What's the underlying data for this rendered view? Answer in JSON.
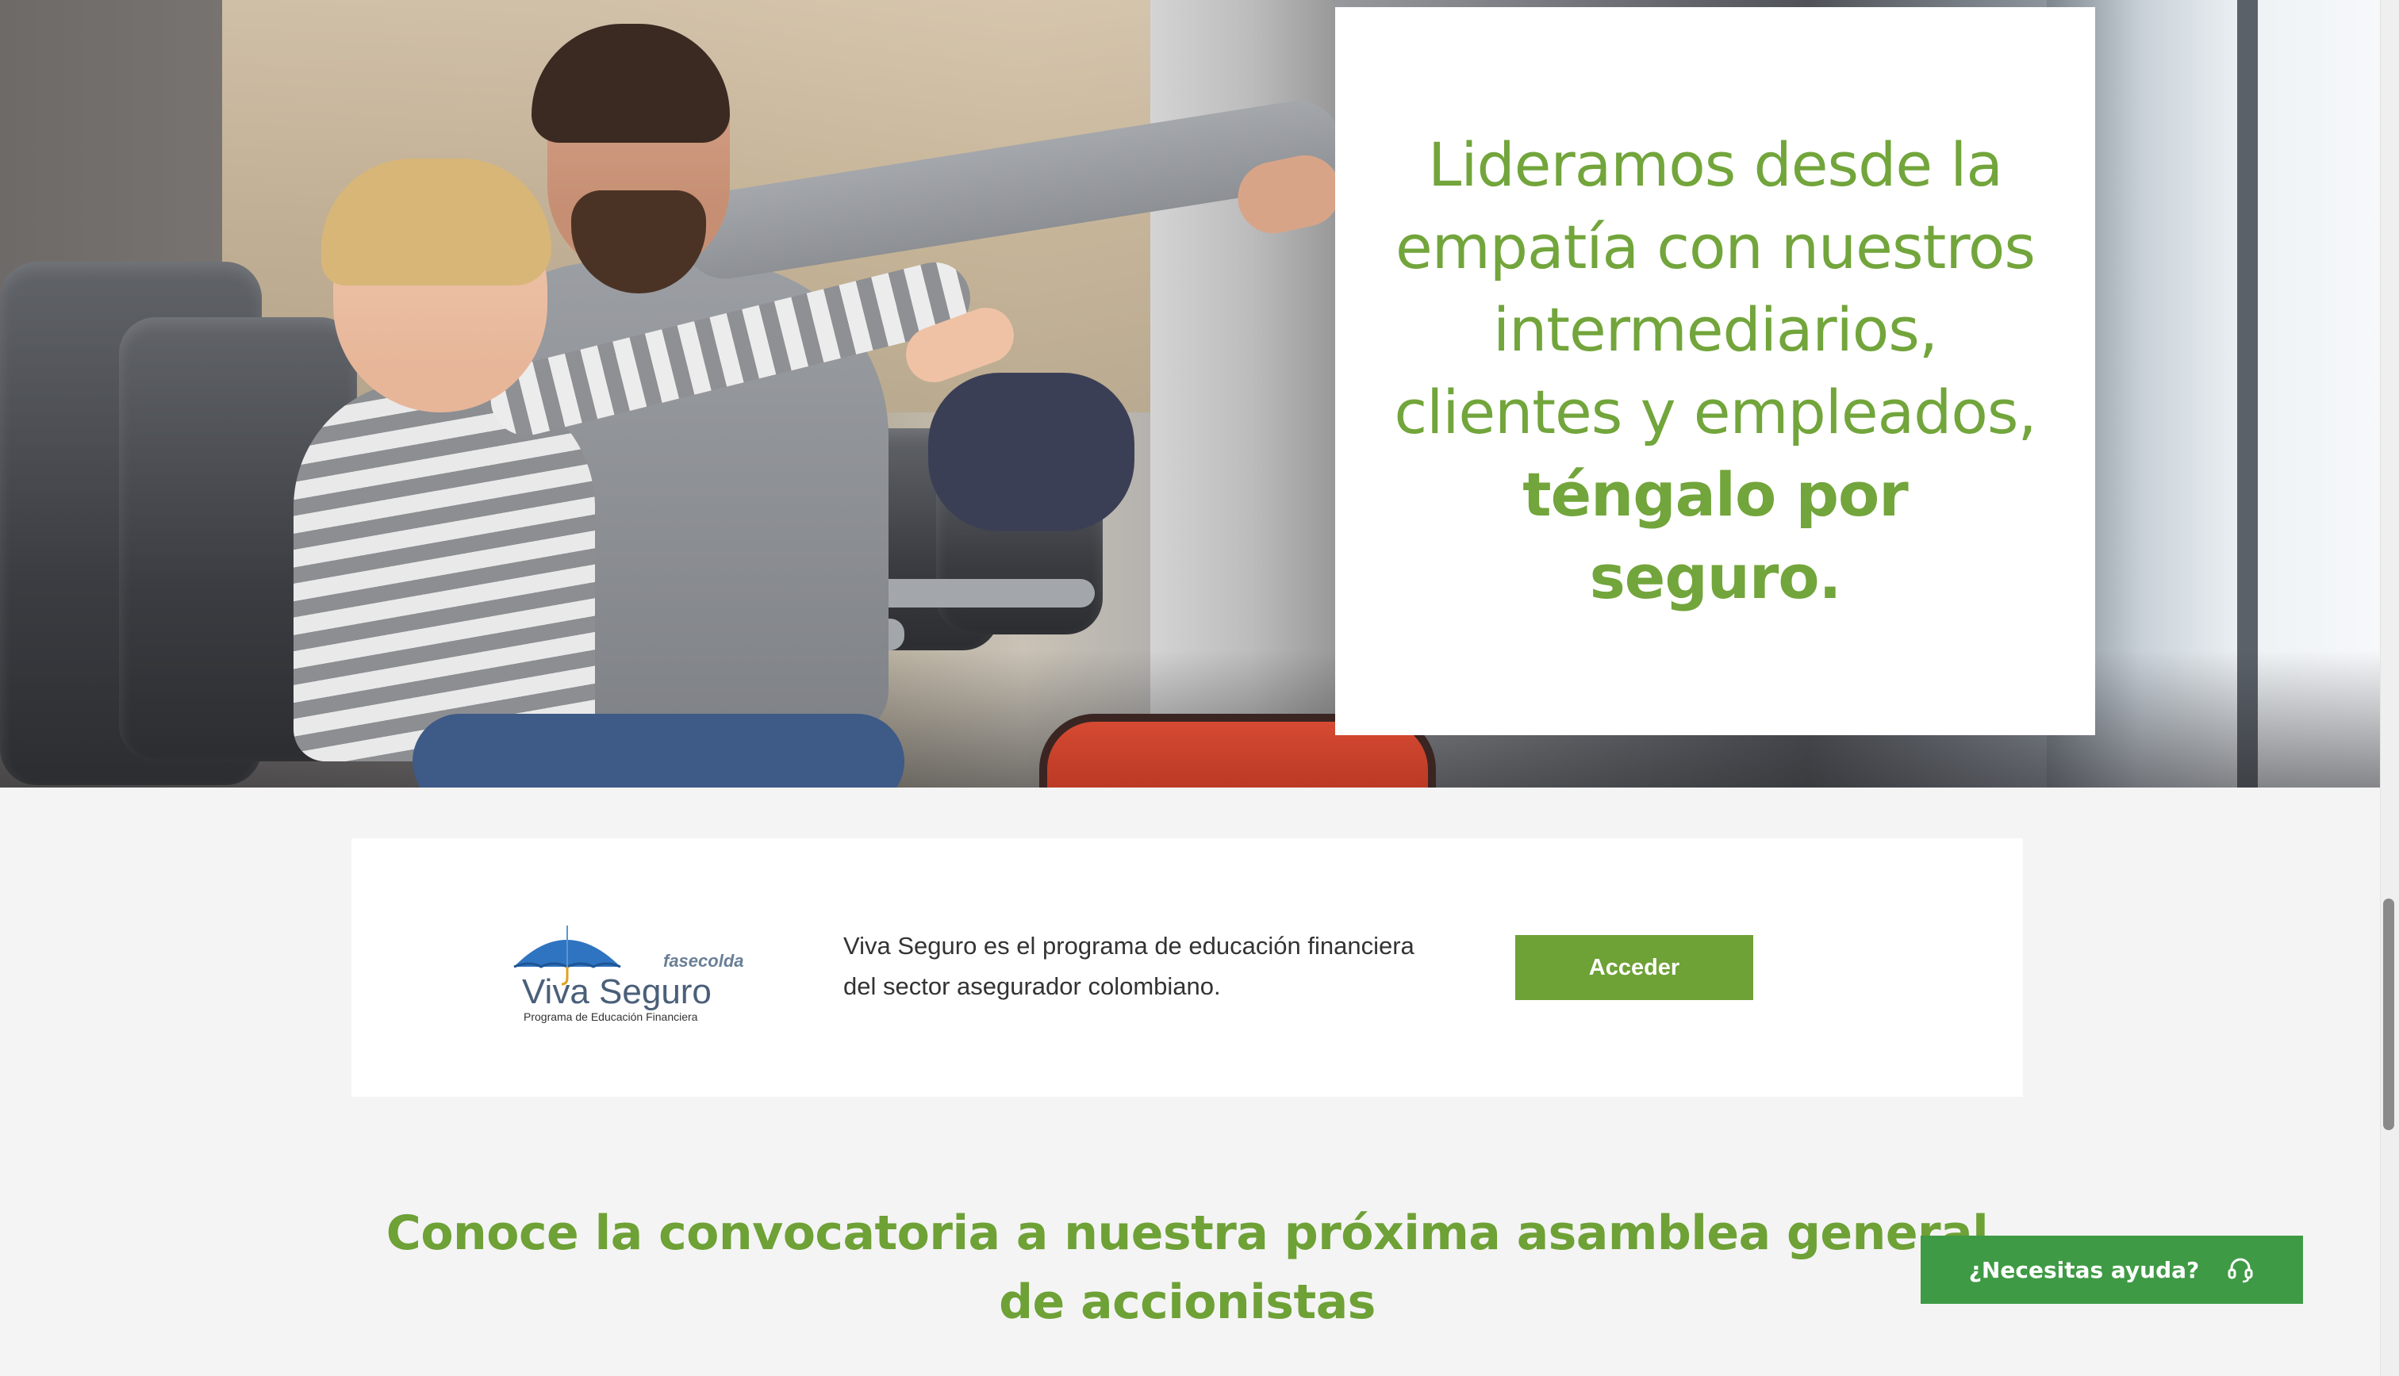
{
  "hero": {
    "headline_regular": "Lideramos desde la empatía con nuestros intermediarios, clientes y empleados, ",
    "headline_bold": "téngalo por seguro."
  },
  "viva_seguro": {
    "logo_text": "Viva Seguro",
    "logo_brand": "fasecolda",
    "logo_tagline": "Programa de Educación Financiera",
    "description": "Viva Seguro es el programa de educación financiera del sector asegurador colombiano.",
    "button_label": "Acceder"
  },
  "assembly": {
    "heading": "Conoce la convocatoria a nuestra próxima asamblea general de accionistas"
  },
  "help": {
    "label": "¿Necesitas ayuda?",
    "icon": "headset-icon"
  },
  "colors": {
    "brand_green": "#72a53b",
    "button_green": "#6ea136",
    "help_green": "#3f9a45",
    "page_background": "#f4f4f4",
    "umbrella_blue": "#2f74c0"
  }
}
